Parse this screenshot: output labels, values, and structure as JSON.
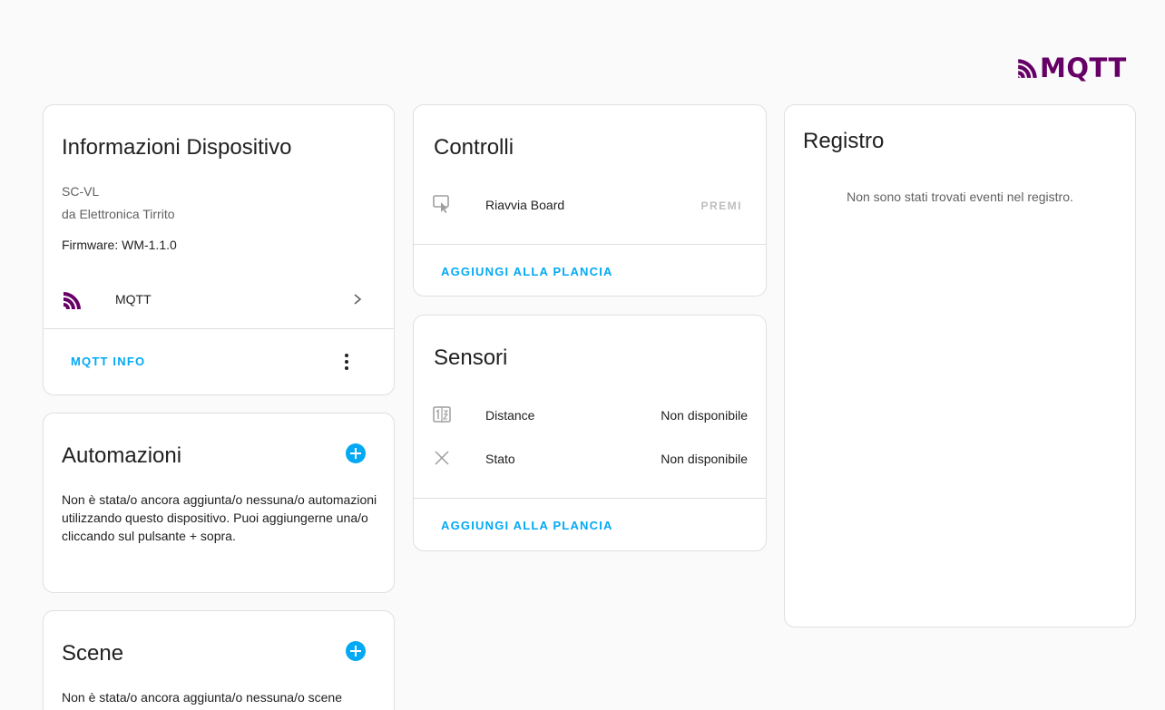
{
  "header": {
    "logo_text": "MQTT"
  },
  "device_info": {
    "title": "Informazioni Dispositivo",
    "model": "SC-VL",
    "manufacturer": "da Elettronica Tirrito",
    "firmware": "Firmware: WM-1.1.0",
    "integration_label": "MQTT",
    "action_label": "MQTT INFO"
  },
  "automations": {
    "title": "Automazioni",
    "description": "Non è stata/o ancora aggiunta/o nessuna/o automazioni utilizzando questo dispositivo. Puoi aggiungerne una/o cliccando sul pulsante + sopra."
  },
  "scenes": {
    "title": "Scene",
    "description": "Non è stata/o ancora aggiunta/o nessuna/o scene utilizzando questo dispositivo. Puoi aggiungerne una/o cliccando sul pulsante + sopra."
  },
  "controls": {
    "title": "Controlli",
    "entity_name": "Riavvia Board",
    "press_label": "PREMI",
    "action_label": "AGGIUNGI ALLA PLANCIA"
  },
  "sensors": {
    "title": "Sensori",
    "items": [
      {
        "name": "Distance",
        "state": "Non disponibile",
        "icon": "numeric-icon"
      },
      {
        "name": "Stato",
        "state": "Non disponibile",
        "icon": "close-icon"
      }
    ],
    "action_label": "AGGIUNGI ALLA PLANCIA"
  },
  "logbook": {
    "title": "Registro",
    "empty_text": "Non sono stati trovati eventi nel registro."
  },
  "colors": {
    "accent": "#03a9f4",
    "mqtt_brand": "#660066",
    "card_border": "#e0e0e0",
    "background": "#fafafa"
  }
}
